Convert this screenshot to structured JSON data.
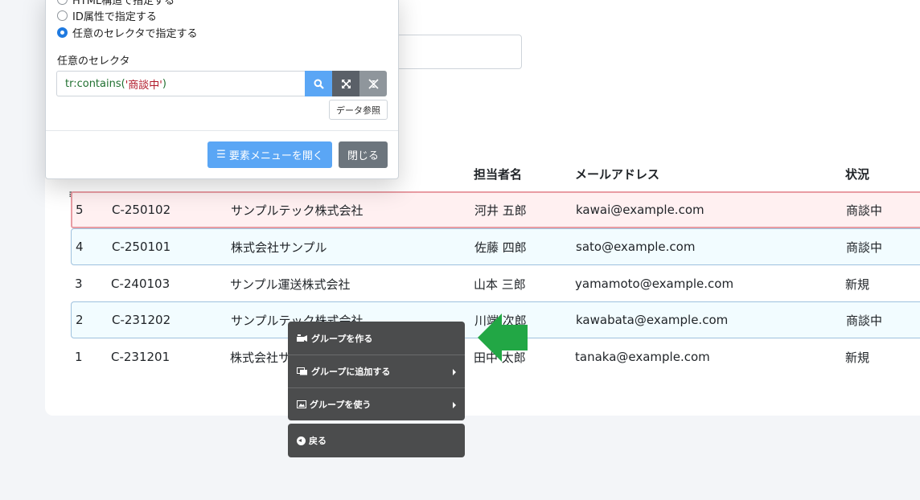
{
  "dialog": {
    "radio_options": [
      {
        "label": "HTML構造で指定する",
        "checked": false
      },
      {
        "label": "ID属性で指定する",
        "checked": false
      },
      {
        "label": "任意のセレクタで指定する",
        "checked": true
      }
    ],
    "selector_label": "任意のセレクタ",
    "selector_value_prefix": "tr:contains(",
    "selector_value_string": "'商談中'",
    "selector_value_suffix": ")",
    "data_ref_label": "データ参照",
    "open_menu_label": "要素メニューを開く",
    "close_label": "閉じる",
    "colors": {
      "search": "#5aa6f5",
      "expand": "#5a6068",
      "collapse": "#8f969c"
    }
  },
  "table": {
    "headers": [
      "担当者名",
      "メールアドレス",
      "状況"
    ],
    "rows": [
      {
        "no": "5",
        "code": "C-250102",
        "company": "サンプルテック株式会社",
        "person": "河井 五郎",
        "email": "kawai@example.com",
        "status": "商談中",
        "style": "active"
      },
      {
        "no": "4",
        "code": "C-250101",
        "company": "株式会社サンプル",
        "person": "佐藤 四郎",
        "email": "sato@example.com",
        "status": "商談中",
        "style": "group"
      },
      {
        "no": "3",
        "code": "C-240103",
        "company": "サンプル運送株式会社",
        "person": "山本 三郎",
        "email": "yamamoto@example.com",
        "status": "新規",
        "style": "plain"
      },
      {
        "no": "2",
        "code": "C-231202",
        "company": "サンプルテック株式会社",
        "person": "川端 次郎",
        "email": "kawabata@example.com",
        "status": "商談中",
        "style": "group"
      },
      {
        "no": "1",
        "code": "C-231201",
        "company": "株式会社サンプル",
        "person": "田中 太郎",
        "email": "tanaka@example.com",
        "status": "新規",
        "style": "plain"
      }
    ]
  },
  "context_menu": {
    "items": [
      {
        "label": "グループを作る",
        "icon": "group-create-icon",
        "has_submenu": false
      },
      {
        "label": "グループに追加する",
        "icon": "group-add-icon",
        "has_submenu": true
      },
      {
        "label": "グループを使う",
        "icon": "group-use-icon",
        "has_submenu": true
      }
    ],
    "back_label": "戻る"
  },
  "pointer": {
    "color": "#22a745"
  }
}
